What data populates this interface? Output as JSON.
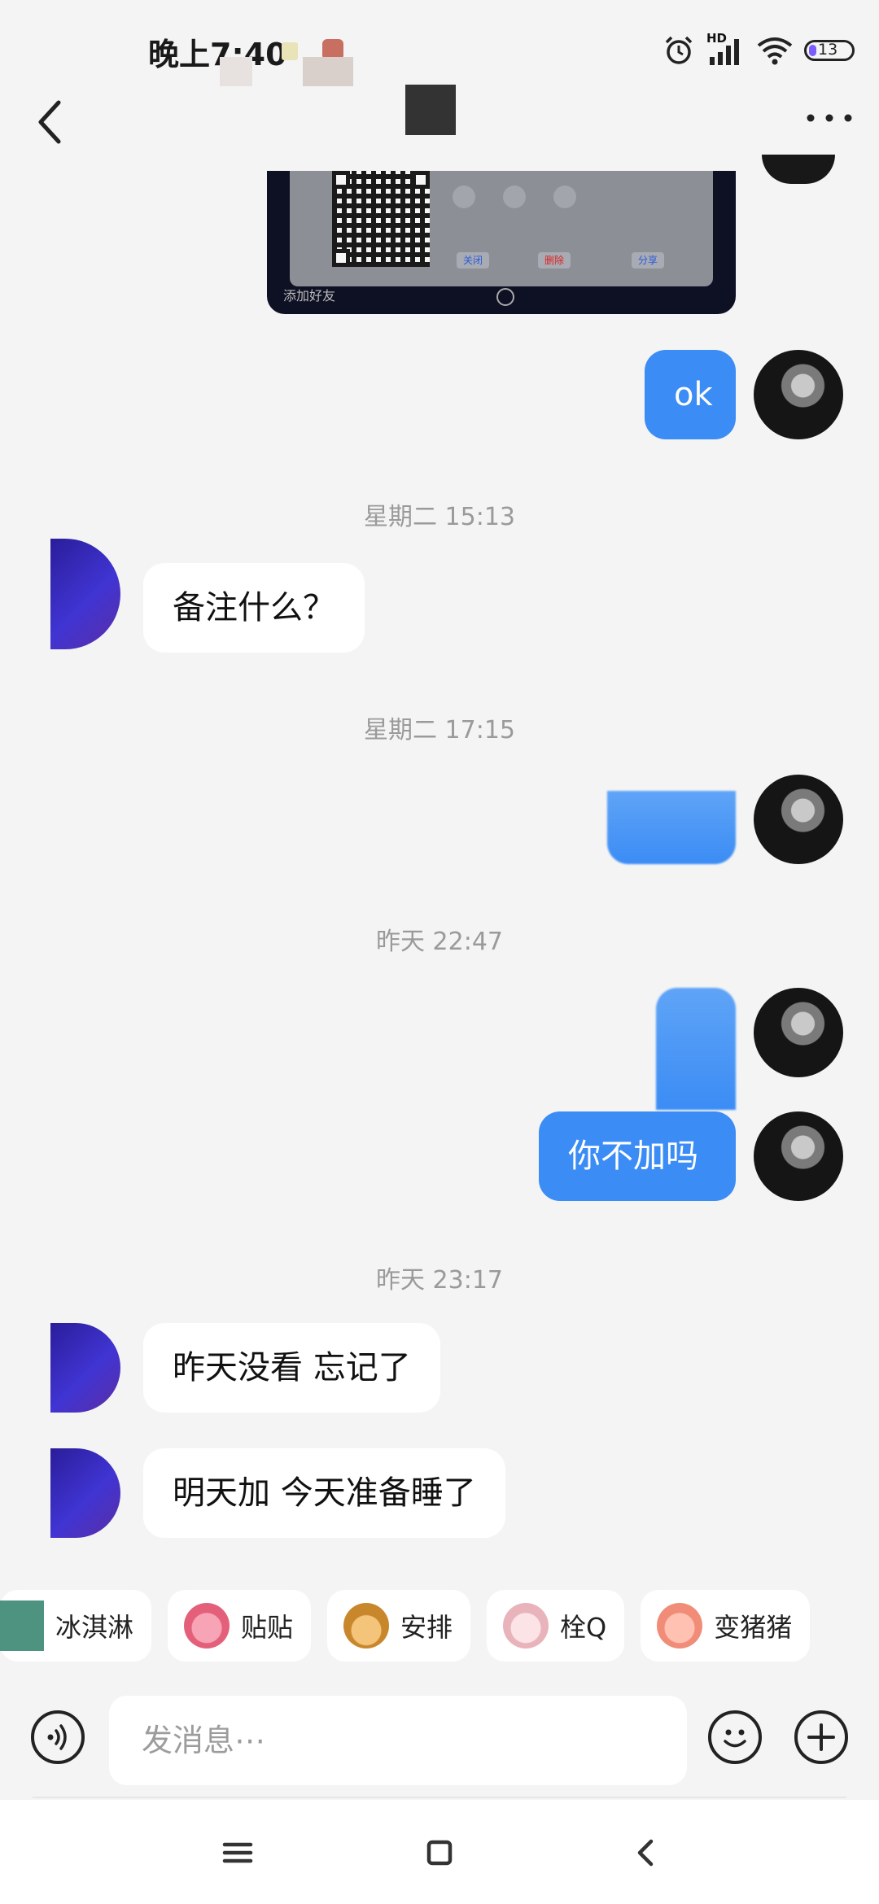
{
  "status_bar": {
    "time": "晚上7:40",
    "network_label": "HD",
    "battery_level": "13"
  },
  "header": {
    "back_label": "",
    "more_label": "⋯"
  },
  "chat": {
    "image_message": {
      "caption": "添加好友",
      "buttons": [
        "关闭",
        "删除",
        "分享"
      ]
    },
    "messages": [
      {
        "sender": "me",
        "text": "ok"
      },
      {
        "sender": "them",
        "text": "备注什么？"
      },
      {
        "sender": "me",
        "text": ""
      },
      {
        "sender": "me",
        "text": ""
      },
      {
        "sender": "me",
        "text": "你不加吗"
      },
      {
        "sender": "them",
        "text": "昨天没看 忘记了"
      },
      {
        "sender": "them",
        "text": "明天加 今天准备睡了"
      }
    ],
    "timestamps": [
      "星期二 15:13",
      "星期二 17:15",
      "昨天 22:47",
      "昨天 23:17"
    ]
  },
  "stickers": [
    {
      "label": "冰淇淋",
      "icon": "ice-cream-sticker"
    },
    {
      "label": "贴贴",
      "icon": "hug-sticker"
    },
    {
      "label": "安排",
      "icon": "arrange-sticker"
    },
    {
      "label": "栓Q",
      "icon": "thank-you-sticker"
    },
    {
      "label": "变猪猪",
      "icon": "pig-sticker"
    }
  ],
  "input_bar": {
    "placeholder": "发消息⋯"
  },
  "colors": {
    "bubble_me": "#3b8cf5",
    "bubble_them": "#ffffff",
    "background": "#f4f4f4"
  }
}
